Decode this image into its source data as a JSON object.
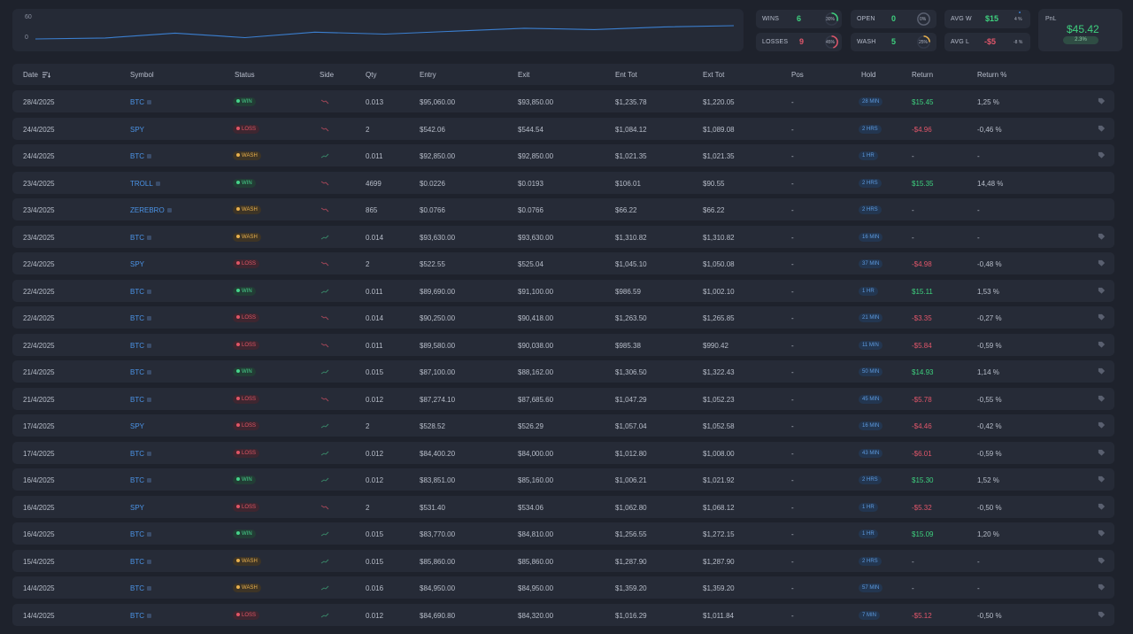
{
  "summary": {
    "equity_curve": {
      "tick_labels": [
        "60",
        "0"
      ],
      "values": [
        0,
        0.3,
        1.8,
        0.4,
        2.1,
        1.5,
        2.4,
        3.3,
        2.9,
        3.7,
        4.1
      ]
    },
    "wins": {
      "label": "WINS",
      "value": "6",
      "pct": "30%",
      "pct_value": 30,
      "color": "#3ed07e"
    },
    "losses": {
      "label": "LOSSES",
      "value": "9",
      "pct": "45%",
      "pct_value": 45,
      "color": "#e0566a"
    },
    "open": {
      "label": "OPEN",
      "value": "0",
      "pct": "0%",
      "pct_value": 0,
      "color": "#3ed07e"
    },
    "wash": {
      "label": "WASH",
      "value": "5",
      "pct": "25%",
      "pct_value": 25,
      "color": "#3ed07e"
    },
    "avg_win": {
      "label": "AVG W",
      "value": "$15",
      "pct": "4 %",
      "color": "#3ed07e"
    },
    "avg_loss": {
      "label": "AVG L",
      "value": "-$5",
      "pct": "-8 %",
      "color": "#e0566a"
    },
    "pnl": {
      "label": "PnL",
      "value": "$45.42",
      "pct": "2.3%"
    }
  },
  "columns": {
    "date": "Date",
    "symbol": "Symbol",
    "status": "Status",
    "side": "Side",
    "qty": "Qty",
    "entry": "Entry",
    "exit": "Exit",
    "ent_tot": "Ent Tot",
    "ext_tot": "Ext Tot",
    "pos": "Pos",
    "hold": "Hold",
    "return": "Return",
    "return_pct": "Return %"
  },
  "colors": {
    "win": "#46d38b",
    "loss": "#e05565",
    "wash": "#e8b04d",
    "link": "#4b93e6"
  },
  "trades": [
    {
      "date": "28/4/2025",
      "symbol": "BTC",
      "sym_icon": true,
      "status": "WIN",
      "side": "short",
      "qty": "0.013",
      "entry": "$95,060.00",
      "exit": "$93,850.00",
      "ent_tot": "$1,235.78",
      "ext_tot": "$1,220.05",
      "pos": "-",
      "hold": "28 MIN",
      "ret": "$15.45",
      "ret_pct": "1,25 %",
      "tag": true
    },
    {
      "date": "24/4/2025",
      "symbol": "SPY",
      "sym_icon": false,
      "status": "LOSS",
      "side": "short",
      "qty": "2",
      "entry": "$542.06",
      "exit": "$544.54",
      "ent_tot": "$1,084.12",
      "ext_tot": "$1,089.08",
      "pos": "-",
      "hold": "2 HRS",
      "ret": "-$4.96",
      "ret_pct": "-0,46 %",
      "tag": true
    },
    {
      "date": "24/4/2025",
      "symbol": "BTC",
      "sym_icon": true,
      "status": "WASH",
      "side": "long",
      "qty": "0.011",
      "entry": "$92,850.00",
      "exit": "$92,850.00",
      "ent_tot": "$1,021.35",
      "ext_tot": "$1,021.35",
      "pos": "-",
      "hold": "1 HR",
      "ret": "-",
      "ret_pct": "-",
      "tag": true
    },
    {
      "date": "23/4/2025",
      "symbol": "TROLL",
      "sym_icon": true,
      "status": "WIN",
      "side": "short",
      "qty": "4699",
      "entry": "$0.0226",
      "exit": "$0.0193",
      "ent_tot": "$106.01",
      "ext_tot": "$90.55",
      "pos": "-",
      "hold": "2 HRS",
      "ret": "$15.35",
      "ret_pct": "14,48 %",
      "tag": false
    },
    {
      "date": "23/4/2025",
      "symbol": "ZEREBRO",
      "sym_icon": true,
      "status": "WASH",
      "side": "short",
      "qty": "865",
      "entry": "$0.0766",
      "exit": "$0.0766",
      "ent_tot": "$66.22",
      "ext_tot": "$66.22",
      "pos": "-",
      "hold": "2 HRS",
      "ret": "-",
      "ret_pct": "-",
      "tag": false
    },
    {
      "date": "23/4/2025",
      "symbol": "BTC",
      "sym_icon": true,
      "status": "WASH",
      "side": "long",
      "qty": "0.014",
      "entry": "$93,630.00",
      "exit": "$93,630.00",
      "ent_tot": "$1,310.82",
      "ext_tot": "$1,310.82",
      "pos": "-",
      "hold": "16 MIN",
      "ret": "-",
      "ret_pct": "-",
      "tag": true
    },
    {
      "date": "22/4/2025",
      "symbol": "SPY",
      "sym_icon": false,
      "status": "LOSS",
      "side": "short",
      "qty": "2",
      "entry": "$522.55",
      "exit": "$525.04",
      "ent_tot": "$1,045.10",
      "ext_tot": "$1,050.08",
      "pos": "-",
      "hold": "37 MIN",
      "ret": "-$4.98",
      "ret_pct": "-0,48 %",
      "tag": true
    },
    {
      "date": "22/4/2025",
      "symbol": "BTC",
      "sym_icon": true,
      "status": "WIN",
      "side": "long",
      "qty": "0.011",
      "entry": "$89,690.00",
      "exit": "$91,100.00",
      "ent_tot": "$986.59",
      "ext_tot": "$1,002.10",
      "pos": "-",
      "hold": "1 HR",
      "ret": "$15.11",
      "ret_pct": "1,53 %",
      "tag": true
    },
    {
      "date": "22/4/2025",
      "symbol": "BTC",
      "sym_icon": true,
      "status": "LOSS",
      "side": "short",
      "qty": "0.014",
      "entry": "$90,250.00",
      "exit": "$90,418.00",
      "ent_tot": "$1,263.50",
      "ext_tot": "$1,265.85",
      "pos": "-",
      "hold": "21 MIN",
      "ret": "-$3.35",
      "ret_pct": "-0,27 %",
      "tag": true
    },
    {
      "date": "22/4/2025",
      "symbol": "BTC",
      "sym_icon": true,
      "status": "LOSS",
      "side": "short",
      "qty": "0.011",
      "entry": "$89,580.00",
      "exit": "$90,038.00",
      "ent_tot": "$985.38",
      "ext_tot": "$990.42",
      "pos": "-",
      "hold": "11 MIN",
      "ret": "-$5.84",
      "ret_pct": "-0,59 %",
      "tag": true
    },
    {
      "date": "21/4/2025",
      "symbol": "BTC",
      "sym_icon": true,
      "status": "WIN",
      "side": "long",
      "qty": "0.015",
      "entry": "$87,100.00",
      "exit": "$88,162.00",
      "ent_tot": "$1,306.50",
      "ext_tot": "$1,322.43",
      "pos": "-",
      "hold": "50 MIN",
      "ret": "$14.93",
      "ret_pct": "1,14 %",
      "tag": true
    },
    {
      "date": "21/4/2025",
      "symbol": "BTC",
      "sym_icon": true,
      "status": "LOSS",
      "side": "short",
      "qty": "0.012",
      "entry": "$87,274.10",
      "exit": "$87,685.60",
      "ent_tot": "$1,047.29",
      "ext_tot": "$1,052.23",
      "pos": "-",
      "hold": "45 MIN",
      "ret": "-$5.78",
      "ret_pct": "-0,55 %",
      "tag": true
    },
    {
      "date": "17/4/2025",
      "symbol": "SPY",
      "sym_icon": false,
      "status": "LOSS",
      "side": "long",
      "qty": "2",
      "entry": "$528.52",
      "exit": "$526.29",
      "ent_tot": "$1,057.04",
      "ext_tot": "$1,052.58",
      "pos": "-",
      "hold": "16 MIN",
      "ret": "-$4.46",
      "ret_pct": "-0,42 %",
      "tag": true
    },
    {
      "date": "17/4/2025",
      "symbol": "BTC",
      "sym_icon": true,
      "status": "LOSS",
      "side": "long",
      "qty": "0.012",
      "entry": "$84,400.20",
      "exit": "$84,000.00",
      "ent_tot": "$1,012.80",
      "ext_tot": "$1,008.00",
      "pos": "-",
      "hold": "43 MIN",
      "ret": "-$6.01",
      "ret_pct": "-0,59 %",
      "tag": true
    },
    {
      "date": "16/4/2025",
      "symbol": "BTC",
      "sym_icon": true,
      "status": "WIN",
      "side": "long",
      "qty": "0.012",
      "entry": "$83,851.00",
      "exit": "$85,160.00",
      "ent_tot": "$1,006.21",
      "ext_tot": "$1,021.92",
      "pos": "-",
      "hold": "2 HRS",
      "ret": "$15.30",
      "ret_pct": "1,52 %",
      "tag": true
    },
    {
      "date": "16/4/2025",
      "symbol": "SPY",
      "sym_icon": false,
      "status": "LOSS",
      "side": "short",
      "qty": "2",
      "entry": "$531.40",
      "exit": "$534.06",
      "ent_tot": "$1,062.80",
      "ext_tot": "$1,068.12",
      "pos": "-",
      "hold": "1 HR",
      "ret": "-$5.32",
      "ret_pct": "-0,50 %",
      "tag": true
    },
    {
      "date": "16/4/2025",
      "symbol": "BTC",
      "sym_icon": true,
      "status": "WIN",
      "side": "long",
      "qty": "0.015",
      "entry": "$83,770.00",
      "exit": "$84,810.00",
      "ent_tot": "$1,256.55",
      "ext_tot": "$1,272.15",
      "pos": "-",
      "hold": "1 HR",
      "ret": "$15.09",
      "ret_pct": "1,20 %",
      "tag": true
    },
    {
      "date": "15/4/2025",
      "symbol": "BTC",
      "sym_icon": true,
      "status": "WASH",
      "side": "long",
      "qty": "0.015",
      "entry": "$85,860.00",
      "exit": "$85,860.00",
      "ent_tot": "$1,287.90",
      "ext_tot": "$1,287.90",
      "pos": "-",
      "hold": "2 HRS",
      "ret": "-",
      "ret_pct": "-",
      "tag": true
    },
    {
      "date": "14/4/2025",
      "symbol": "BTC",
      "sym_icon": true,
      "status": "WASH",
      "side": "long",
      "qty": "0.016",
      "entry": "$84,950.00",
      "exit": "$84,950.00",
      "ent_tot": "$1,359.20",
      "ext_tot": "$1,359.20",
      "pos": "-",
      "hold": "57 MIN",
      "ret": "-",
      "ret_pct": "-",
      "tag": true
    },
    {
      "date": "14/4/2025",
      "symbol": "BTC",
      "sym_icon": true,
      "status": "LOSS",
      "side": "long",
      "qty": "0.012",
      "entry": "$84,690.80",
      "exit": "$84,320.00",
      "ent_tot": "$1,016.29",
      "ext_tot": "$1,011.84",
      "pos": "-",
      "hold": "7 MIN",
      "ret": "-$5.12",
      "ret_pct": "-0,50 %",
      "tag": true
    }
  ]
}
